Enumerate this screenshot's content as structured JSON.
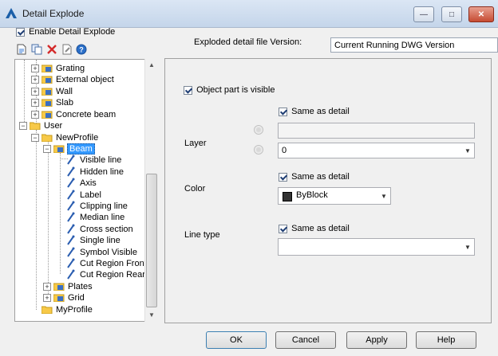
{
  "window": {
    "title": "Detail Explode",
    "minimize_label": "—",
    "maximize_label": "□",
    "close_label": "✕"
  },
  "enable_detail_explode": {
    "label": "Enable Detail Explode",
    "checked": true
  },
  "version": {
    "label": "Exploded detail file Version:",
    "value": "Current Running DWG Version"
  },
  "toolbar": {
    "icons": [
      "new-icon",
      "copy-icon",
      "delete-icon",
      "rename-icon",
      "help-icon"
    ]
  },
  "tree": {
    "items": [
      {
        "label": "Grating"
      },
      {
        "label": "External object"
      },
      {
        "label": "Wall"
      },
      {
        "label": "Slab"
      },
      {
        "label": "Concrete beam"
      },
      {
        "label": "User"
      },
      {
        "label": "NewProfile"
      },
      {
        "label": "Beam"
      },
      {
        "label": "Visible line"
      },
      {
        "label": "Hidden line"
      },
      {
        "label": "Axis"
      },
      {
        "label": "Label"
      },
      {
        "label": "Clipping line"
      },
      {
        "label": "Median line"
      },
      {
        "label": "Cross section"
      },
      {
        "label": "Single line"
      },
      {
        "label": "Symbol Visible"
      },
      {
        "label": "Cut Region Front"
      },
      {
        "label": "Cut Region Rear"
      },
      {
        "label": "Plates"
      },
      {
        "label": "Grid"
      },
      {
        "label": "MyProfile"
      }
    ]
  },
  "panel": {
    "object_part_visible": {
      "label": "Object part is visible",
      "checked": true
    },
    "layer": {
      "label": "Layer",
      "same_as_detail": "Same as detail",
      "text_value": "",
      "combo_value": "0"
    },
    "color": {
      "label": "Color",
      "same_as_detail": "Same as detail",
      "value": "ByBlock"
    },
    "line_type": {
      "label": "Line type",
      "same_as_detail": "Same as detail",
      "value": ""
    }
  },
  "buttons": {
    "ok": "OK",
    "cancel": "Cancel",
    "apply": "Apply",
    "help": "Help"
  },
  "colors": {
    "selection": "#3399ff",
    "accent": "#1f3e74"
  }
}
